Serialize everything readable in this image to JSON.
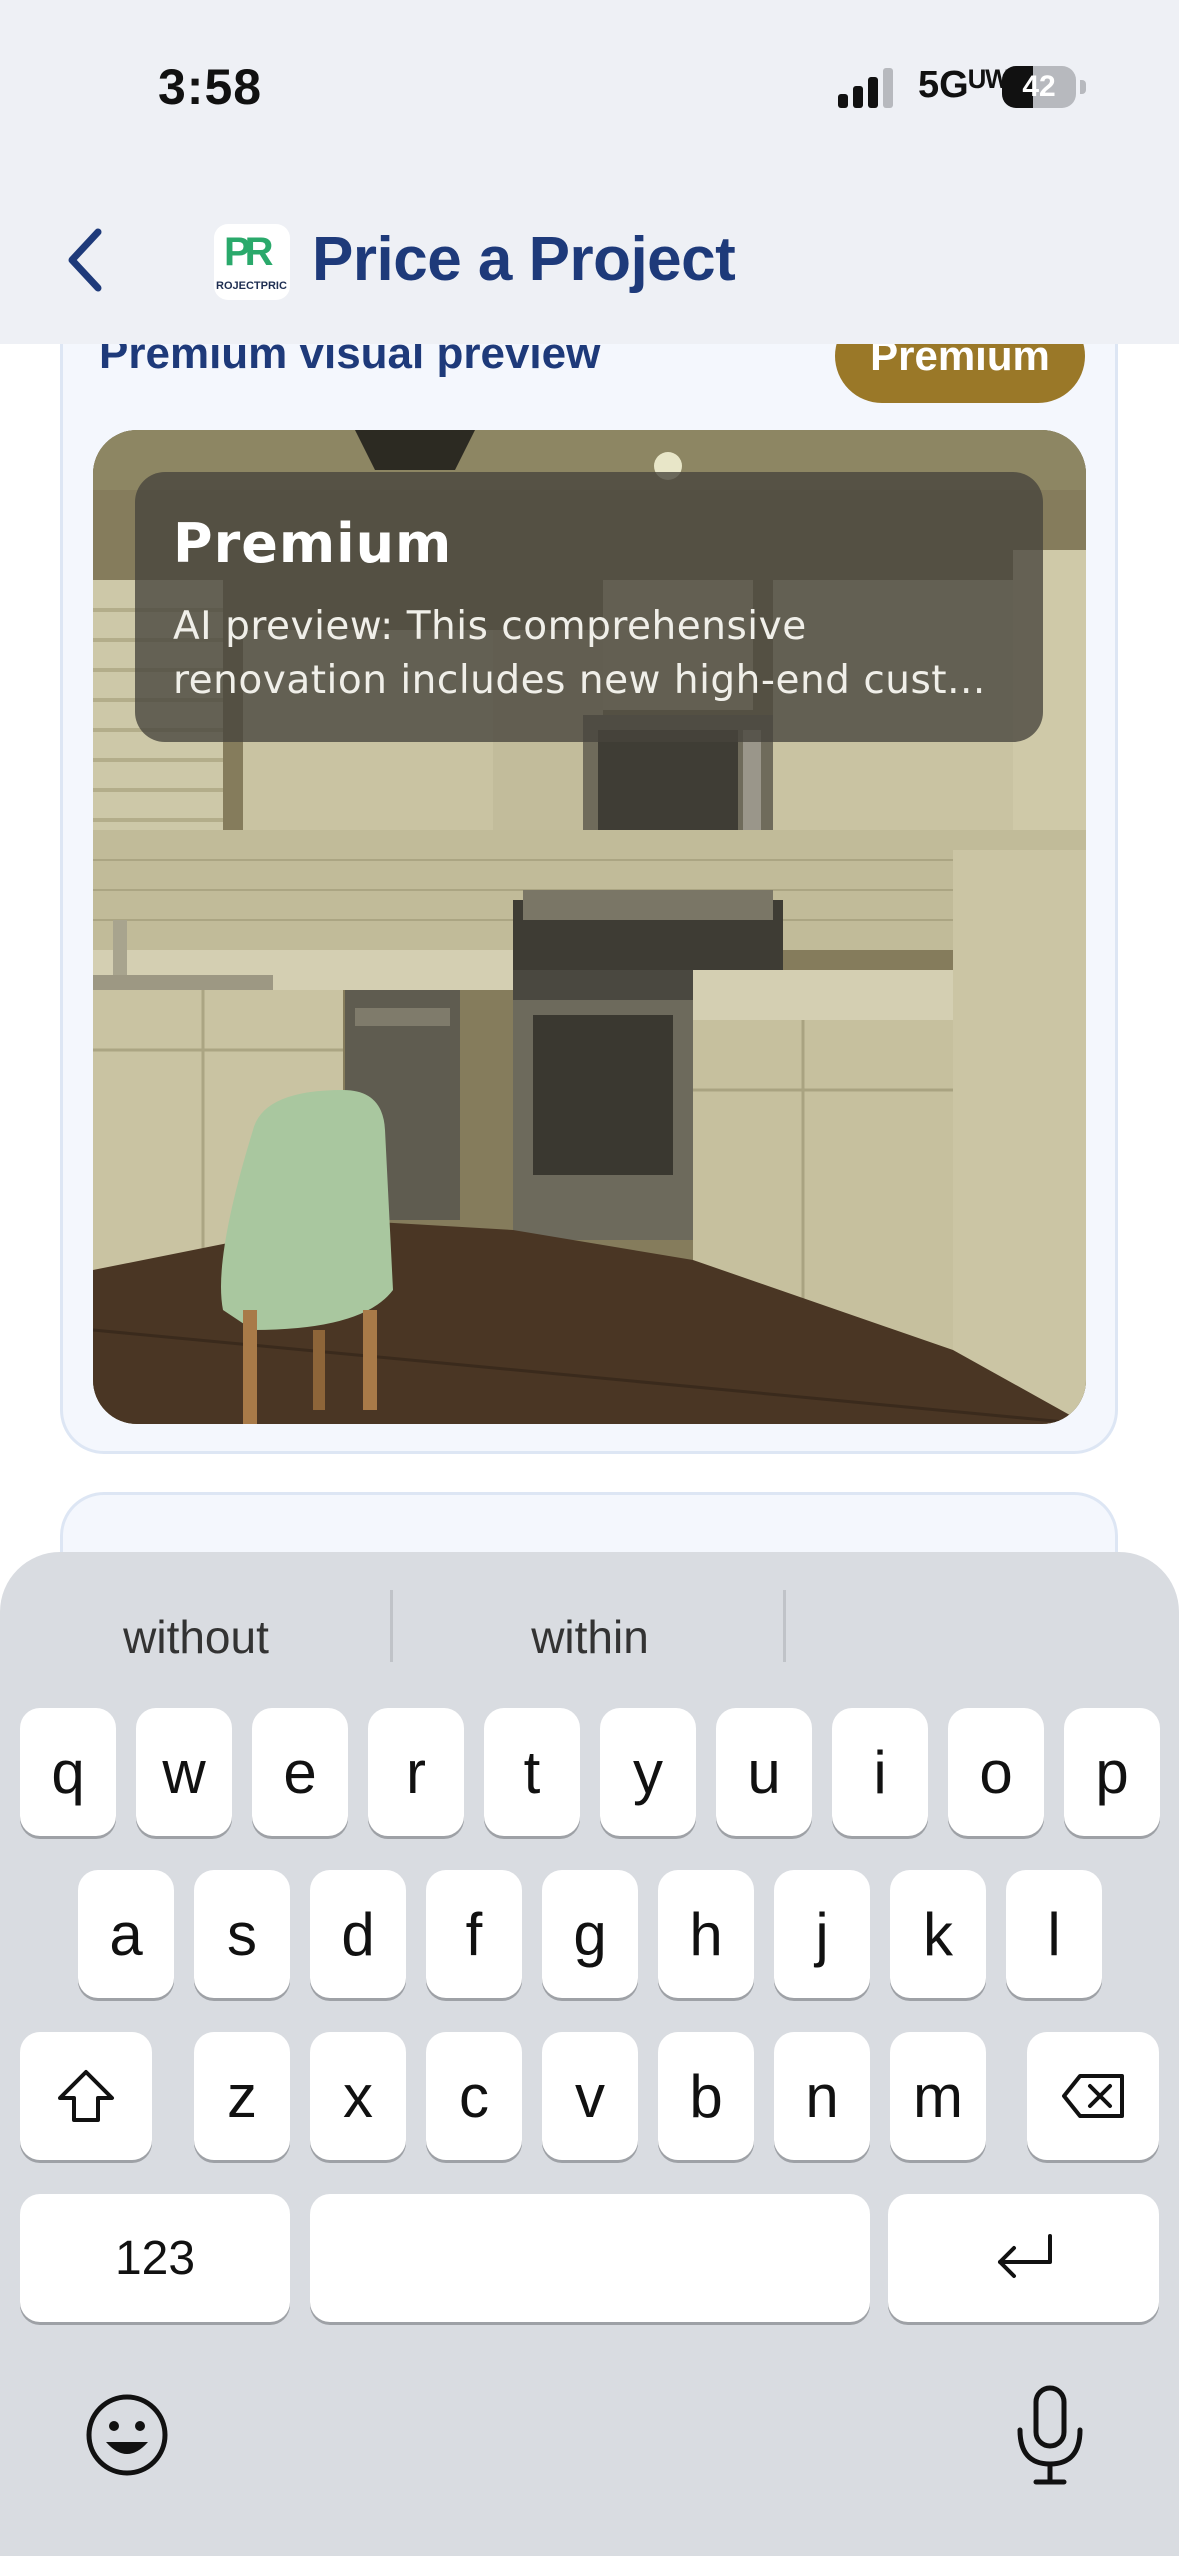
{
  "status_bar": {
    "time": "3:58",
    "network": "5Gᵁᵂ",
    "battery_level": "42"
  },
  "header": {
    "title": "Price a Project",
    "logo_letters": "PR",
    "logo_subtitle": "ROJECTPRIC"
  },
  "preview_card": {
    "title": "Premium visual preview",
    "tier_badge": "Premium",
    "overlay_title": "Premium",
    "overlay_description": "AI preview: This comprehensive renovation includes new high-end cust..."
  },
  "keyboard": {
    "suggestions": [
      "without",
      "within",
      ""
    ],
    "row1": [
      "q",
      "w",
      "e",
      "r",
      "t",
      "y",
      "u",
      "i",
      "o",
      "p"
    ],
    "row2": [
      "a",
      "s",
      "d",
      "f",
      "g",
      "h",
      "j",
      "k",
      "l"
    ],
    "row3": [
      "z",
      "x",
      "c",
      "v",
      "b",
      "n",
      "m"
    ],
    "numbers_key": "123"
  },
  "colors": {
    "brand_navy": "#1e3a7a",
    "premium_gold": "#9a7828",
    "header_bg": "#eef0f5",
    "keyboard_bg": "#d9dce1"
  }
}
